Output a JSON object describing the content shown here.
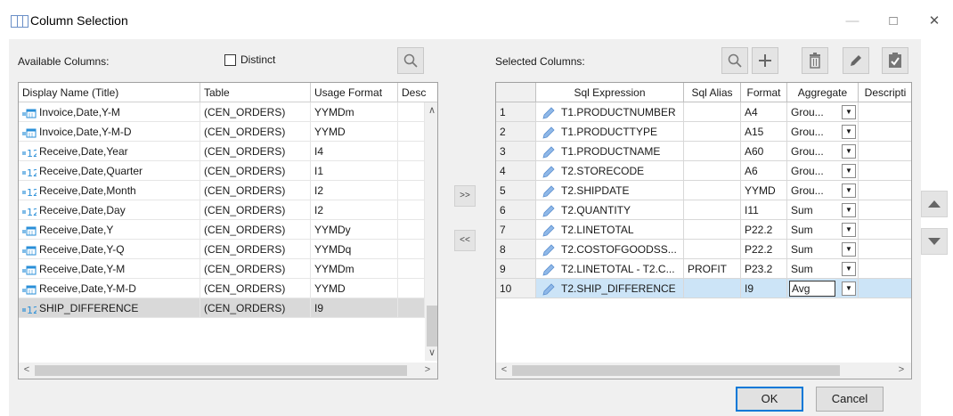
{
  "window": {
    "title": "Column Selection",
    "minimize": "—",
    "maximize": "□",
    "close": "✕"
  },
  "available": {
    "label": "Available Columns:",
    "distinct_label": "Distinct",
    "distinct_checked": false,
    "columns": [
      "Display Name (Title)",
      "Table",
      "Usage Format",
      "Desc"
    ],
    "rows": [
      {
        "icon": "date",
        "name": "Invoice,Date,Y-M",
        "table": "(CEN_ORDERS)",
        "format": "YYMDm"
      },
      {
        "icon": "date",
        "name": "Invoice,Date,Y-M-D",
        "table": "(CEN_ORDERS)",
        "format": "YYMD"
      },
      {
        "icon": "numeric",
        "name": "Receive,Date,Year",
        "table": "(CEN_ORDERS)",
        "format": "I4"
      },
      {
        "icon": "numeric",
        "name": "Receive,Date,Quarter",
        "table": "(CEN_ORDERS)",
        "format": "I1"
      },
      {
        "icon": "numeric",
        "name": "Receive,Date,Month",
        "table": "(CEN_ORDERS)",
        "format": "I2"
      },
      {
        "icon": "numeric",
        "name": "Receive,Date,Day",
        "table": "(CEN_ORDERS)",
        "format": "I2"
      },
      {
        "icon": "date",
        "name": "Receive,Date,Y",
        "table": "(CEN_ORDERS)",
        "format": "YYMDy"
      },
      {
        "icon": "date",
        "name": "Receive,Date,Y-Q",
        "table": "(CEN_ORDERS)",
        "format": "YYMDq"
      },
      {
        "icon": "date",
        "name": "Receive,Date,Y-M",
        "table": "(CEN_ORDERS)",
        "format": "YYMDm"
      },
      {
        "icon": "date",
        "name": "Receive,Date,Y-M-D",
        "table": "(CEN_ORDERS)",
        "format": "YYMD"
      },
      {
        "icon": "numeric",
        "name": "SHIP_DIFFERENCE",
        "table": "(CEN_ORDERS)",
        "format": "I9",
        "selected": true
      }
    ]
  },
  "transfer": {
    "add": ">>",
    "remove": "<<"
  },
  "selected": {
    "label": "Selected Columns:",
    "columns": [
      "",
      "Sql Expression",
      "Sql Alias",
      "Format",
      "Aggregate",
      "Descripti"
    ],
    "rows": [
      {
        "n": "1",
        "expr": "T1.PRODUCTNUMBER",
        "alias": "",
        "format": "A4",
        "agg": "Grou..."
      },
      {
        "n": "2",
        "expr": "T1.PRODUCTTYPE",
        "alias": "",
        "format": "A15",
        "agg": "Grou..."
      },
      {
        "n": "3",
        "expr": "T1.PRODUCTNAME",
        "alias": "",
        "format": "A60",
        "agg": "Grou..."
      },
      {
        "n": "4",
        "expr": "T2.STORECODE",
        "alias": "",
        "format": "A6",
        "agg": "Grou..."
      },
      {
        "n": "5",
        "expr": "T2.SHIPDATE",
        "alias": "",
        "format": "YYMD",
        "agg": "Grou..."
      },
      {
        "n": "6",
        "expr": "T2.QUANTITY",
        "alias": "",
        "format": "I11",
        "agg": "Sum"
      },
      {
        "n": "7",
        "expr": "T2.LINETOTAL",
        "alias": "",
        "format": "P22.2",
        "agg": "Sum"
      },
      {
        "n": "8",
        "expr": "T2.COSTOFGOODSS...",
        "alias": "",
        "format": "P22.2",
        "agg": "Sum"
      },
      {
        "n": "9",
        "expr": "T2.LINETOTAL - T2.C...",
        "alias": "PROFIT",
        "format": "P23.2",
        "agg": "Sum"
      },
      {
        "n": "10",
        "expr": "T2.SHIP_DIFFERENCE",
        "alias": "",
        "format": "I9",
        "agg": "Avg",
        "active": true
      }
    ]
  },
  "buttons": {
    "ok": "OK",
    "cancel": "Cancel"
  },
  "colors": {
    "accent": "#0078d7",
    "active_row": "#cce4f7",
    "selected_row": "#d9d9d9",
    "icon_blue": "#2a8fd8"
  }
}
